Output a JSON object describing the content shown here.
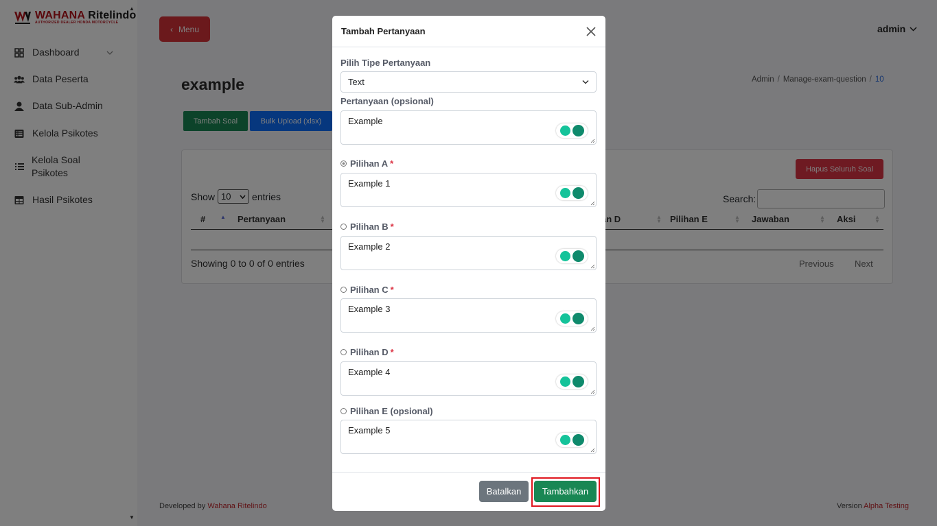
{
  "brand": {
    "name_part1": "WAHANA",
    "name_part2": "Ritelindo",
    "tagline": "AUTHORIZED DEALER HONDA MOTORCYCLE"
  },
  "sidebar": {
    "items": [
      {
        "label": "Dashboard",
        "icon": "grid-icon"
      },
      {
        "label": "Data Peserta",
        "icon": "users-icon"
      },
      {
        "label": "Data Sub-Admin",
        "icon": "user-icon"
      },
      {
        "label": "Kelola Psikotes",
        "icon": "list-box-icon"
      },
      {
        "label": "Kelola Soal",
        "label_line2": "Psikotes",
        "icon": "list-icon"
      },
      {
        "label": "Hasil Psikotes",
        "icon": "table-icon"
      }
    ]
  },
  "header": {
    "menu_label": "Menu",
    "user_label": "admin"
  },
  "page": {
    "title": "example",
    "breadcrumb": [
      "Admin",
      "Manage-exam-question",
      "10"
    ],
    "add_button": "Tambah Soal",
    "bulk_button": "Bulk Upload (xlsx)",
    "delete_all_button": "Hapus Seluruh Soal"
  },
  "table": {
    "show_label": "Show",
    "entries_value": "10",
    "entries_label": "entries",
    "search_label": "Search:",
    "columns": [
      "#",
      "Pertanyaan",
      "an D",
      "Pilihan E",
      "Jawaban",
      "Aksi"
    ],
    "info": "Showing 0 to 0 of 0 entries",
    "previous": "Previous",
    "next": "Next"
  },
  "footer": {
    "developed_by": "Developed by",
    "developer": "Wahana Ritelindo",
    "version_label": "Version",
    "version": "Alpha Testing"
  },
  "modal": {
    "title": "Tambah Pertanyaan",
    "type_label": "Pilih Tipe Pertanyaan",
    "type_value": "Text",
    "question_label": "Pertanyaan (opsional)",
    "question_value": "Example",
    "options": [
      {
        "label": "Pilihan A",
        "required": "*",
        "value": "Example 1",
        "checked": true
      },
      {
        "label": "Pilihan B",
        "required": "*",
        "value": "Example 2",
        "checked": false
      },
      {
        "label": "Pilihan C",
        "required": "*",
        "value": "Example 3",
        "checked": false
      },
      {
        "label": "Pilihan D",
        "required": "*",
        "value": "Example 4",
        "checked": false
      },
      {
        "label": "Pilihan E (opsional)",
        "required": "",
        "value": "Example 5",
        "checked": false
      }
    ],
    "cancel_label": "Batalkan",
    "submit_label": "Tambahkan"
  },
  "colors": {
    "primary_red": "#d63339",
    "success_green": "#198754",
    "blue": "#0d6efd",
    "highlight": "#e0161e"
  }
}
